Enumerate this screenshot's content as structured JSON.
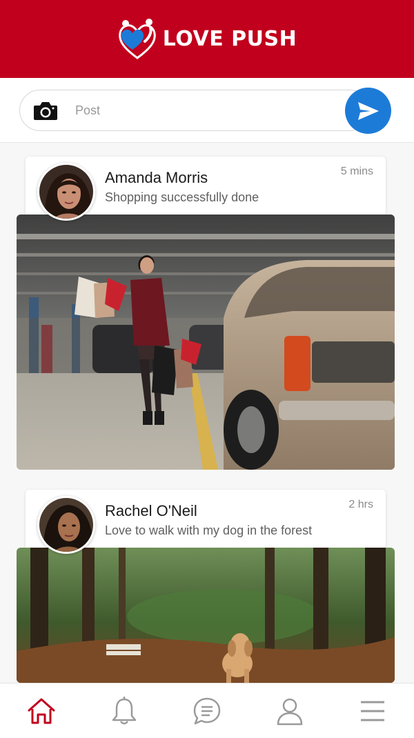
{
  "app": {
    "name": "LOVE PUSH"
  },
  "colors": {
    "brand": "#c1001d",
    "send": "#1d7bd8",
    "active_nav": "#c1001d",
    "inactive_nav": "#9a9a9a"
  },
  "composer": {
    "placeholder": "Post",
    "camera_icon": "camera-icon",
    "send_icon": "paper-plane-icon"
  },
  "posts": [
    {
      "author": "Amanda Morris",
      "text": "Shopping successfully done",
      "time": "5 mins"
    },
    {
      "author": "Rachel O'Neil",
      "text": "Love to walk with my dog in the forest",
      "time": "2 hrs"
    }
  ],
  "nav": [
    {
      "icon": "home-icon",
      "active": true
    },
    {
      "icon": "bell-icon",
      "active": false
    },
    {
      "icon": "chat-icon",
      "active": false
    },
    {
      "icon": "user-icon",
      "active": false
    },
    {
      "icon": "menu-icon",
      "active": false
    }
  ]
}
